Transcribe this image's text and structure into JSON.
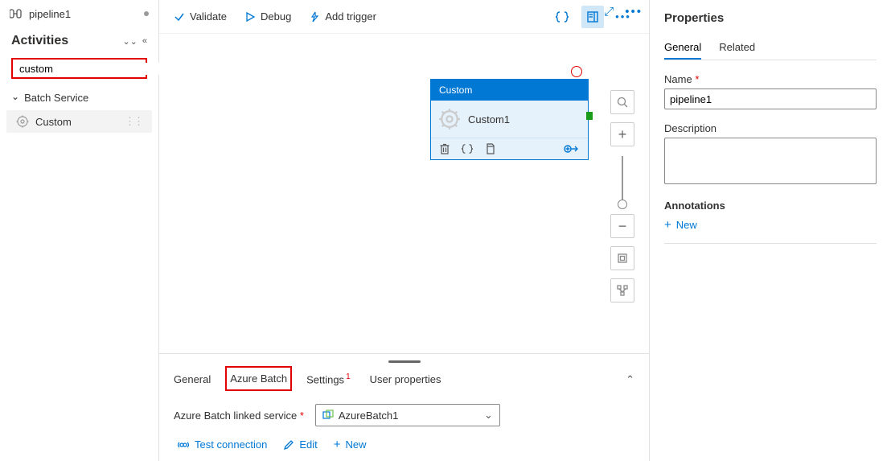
{
  "tab": {
    "title": "pipeline1"
  },
  "activities": {
    "heading": "Activities",
    "search_value": "custom",
    "category": "Batch Service",
    "item": "Custom"
  },
  "toolbar": {
    "validate": "Validate",
    "debug": "Debug",
    "add_trigger": "Add trigger"
  },
  "node": {
    "type": "Custom",
    "name": "Custom1"
  },
  "bottom": {
    "tabs": {
      "general": "General",
      "azure_batch": "Azure Batch",
      "settings": "Settings",
      "settings_badge": "1",
      "user_props": "User properties"
    },
    "linked_label": "Azure Batch linked service",
    "linked_value": "AzureBatch1",
    "test_connection": "Test connection",
    "edit": "Edit",
    "new": "New"
  },
  "props": {
    "title": "Properties",
    "tabs": {
      "general": "General",
      "related": "Related"
    },
    "name_label": "Name",
    "name_value": "pipeline1",
    "desc_label": "Description",
    "annotations_label": "Annotations",
    "new": "New"
  }
}
